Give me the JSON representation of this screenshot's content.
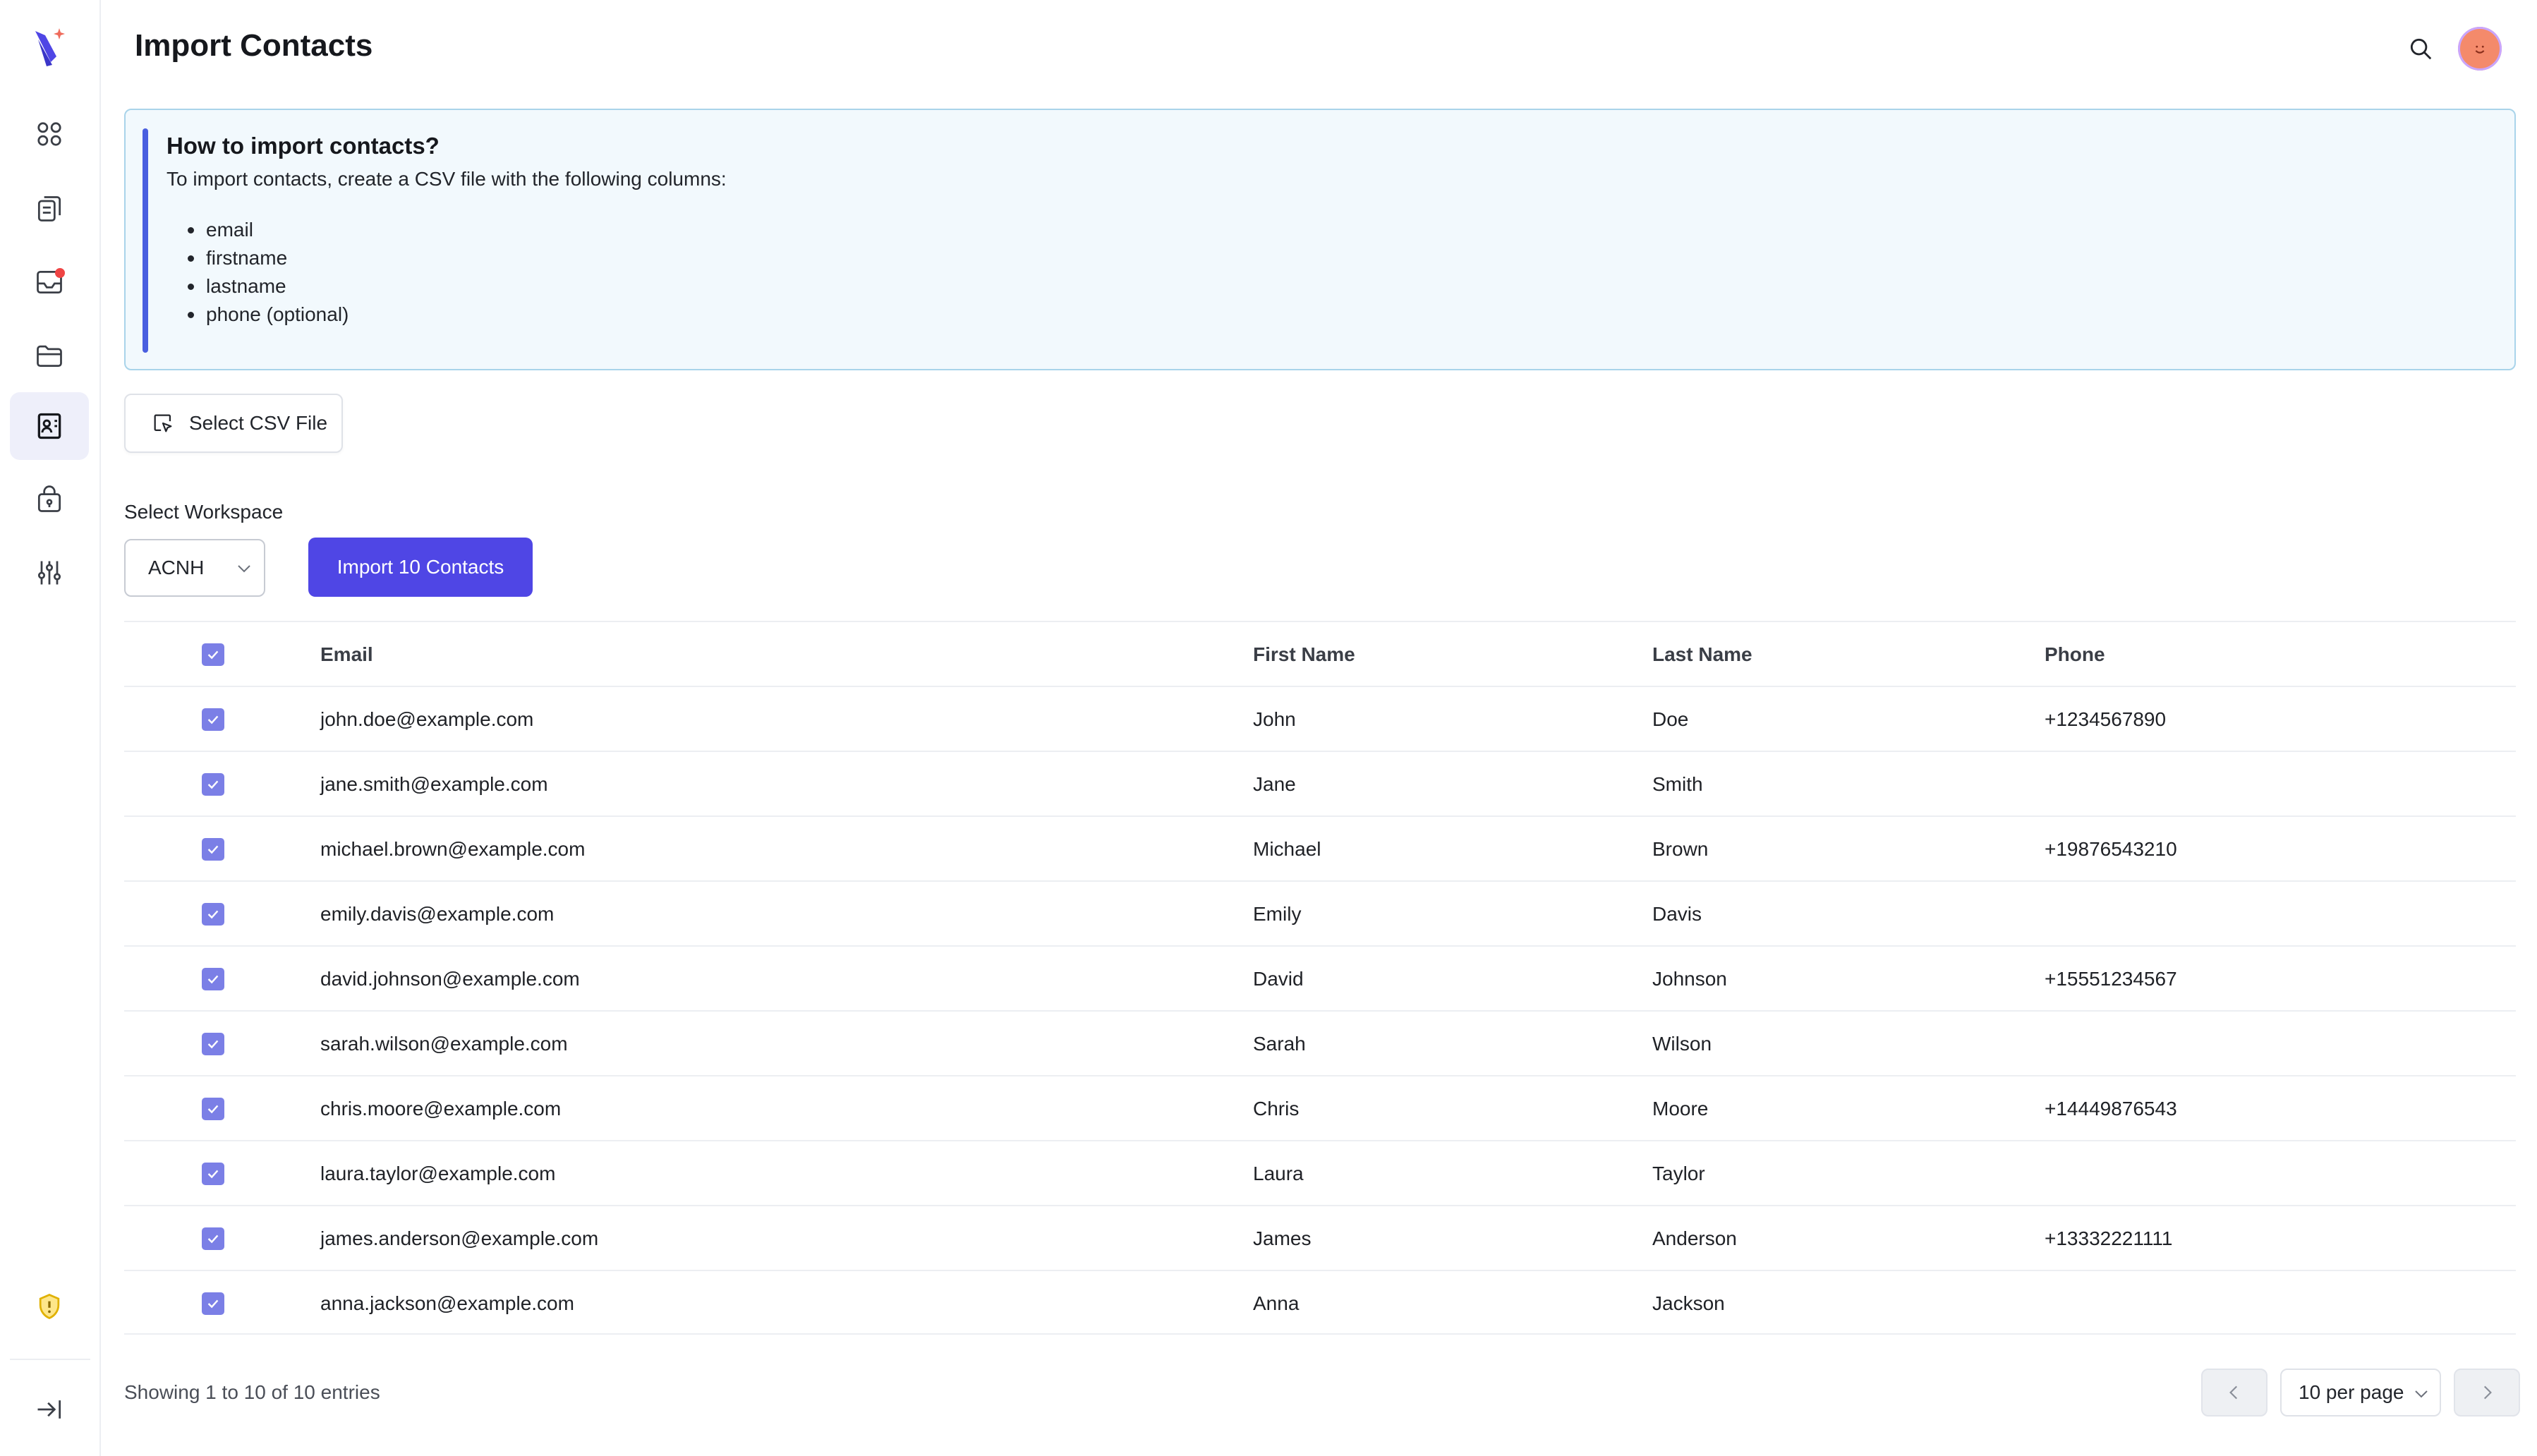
{
  "header": {
    "title": "Import Contacts"
  },
  "sidebar": {
    "items": [
      {
        "icon": "dashboard-icon"
      },
      {
        "icon": "documents-icon"
      },
      {
        "icon": "inbox-icon",
        "notification": true
      },
      {
        "icon": "folder-icon"
      },
      {
        "icon": "contacts-icon",
        "active": true
      },
      {
        "icon": "lock-bag-icon"
      },
      {
        "icon": "sliders-icon"
      }
    ],
    "bottom": [
      {
        "icon": "shield-alert-icon"
      },
      {
        "icon": "collapse-sidebar-icon"
      }
    ]
  },
  "info": {
    "title": "How to import contacts?",
    "text": "To import contacts, create a CSV file with the following columns:",
    "columns": [
      "email",
      "firstname",
      "lastname",
      "phone (optional)"
    ]
  },
  "actions": {
    "select_csv_label": "Select CSV File",
    "workspace_label": "Select Workspace",
    "workspace_value": "ACNH",
    "import_label": "Import 10 Contacts"
  },
  "table": {
    "headers": {
      "email": "Email",
      "first": "First Name",
      "last": "Last Name",
      "phone": "Phone"
    },
    "rows": [
      {
        "email": "john.doe@example.com",
        "first": "John",
        "last": "Doe",
        "phone": "+1234567890"
      },
      {
        "email": "jane.smith@example.com",
        "first": "Jane",
        "last": "Smith",
        "phone": ""
      },
      {
        "email": "michael.brown@example.com",
        "first": "Michael",
        "last": "Brown",
        "phone": "+19876543210"
      },
      {
        "email": "emily.davis@example.com",
        "first": "Emily",
        "last": "Davis",
        "phone": ""
      },
      {
        "email": "david.johnson@example.com",
        "first": "David",
        "last": "Johnson",
        "phone": "+15551234567"
      },
      {
        "email": "sarah.wilson@example.com",
        "first": "Sarah",
        "last": "Wilson",
        "phone": ""
      },
      {
        "email": "chris.moore@example.com",
        "first": "Chris",
        "last": "Moore",
        "phone": "+14449876543"
      },
      {
        "email": "laura.taylor@example.com",
        "first": "Laura",
        "last": "Taylor",
        "phone": ""
      },
      {
        "email": "james.anderson@example.com",
        "first": "James",
        "last": "Anderson",
        "phone": "+13332221111"
      },
      {
        "email": "anna.jackson@example.com",
        "first": "Anna",
        "last": "Jackson",
        "phone": ""
      }
    ]
  },
  "pagination": {
    "showing": "Showing 1 to 10 of 10 entries",
    "per_page": "10 per page"
  },
  "colors": {
    "accent": "#4f46e5",
    "checkbox": "#7b7fe6",
    "info_border": "#a9d4ea",
    "info_bg": "#f2f9fd"
  }
}
